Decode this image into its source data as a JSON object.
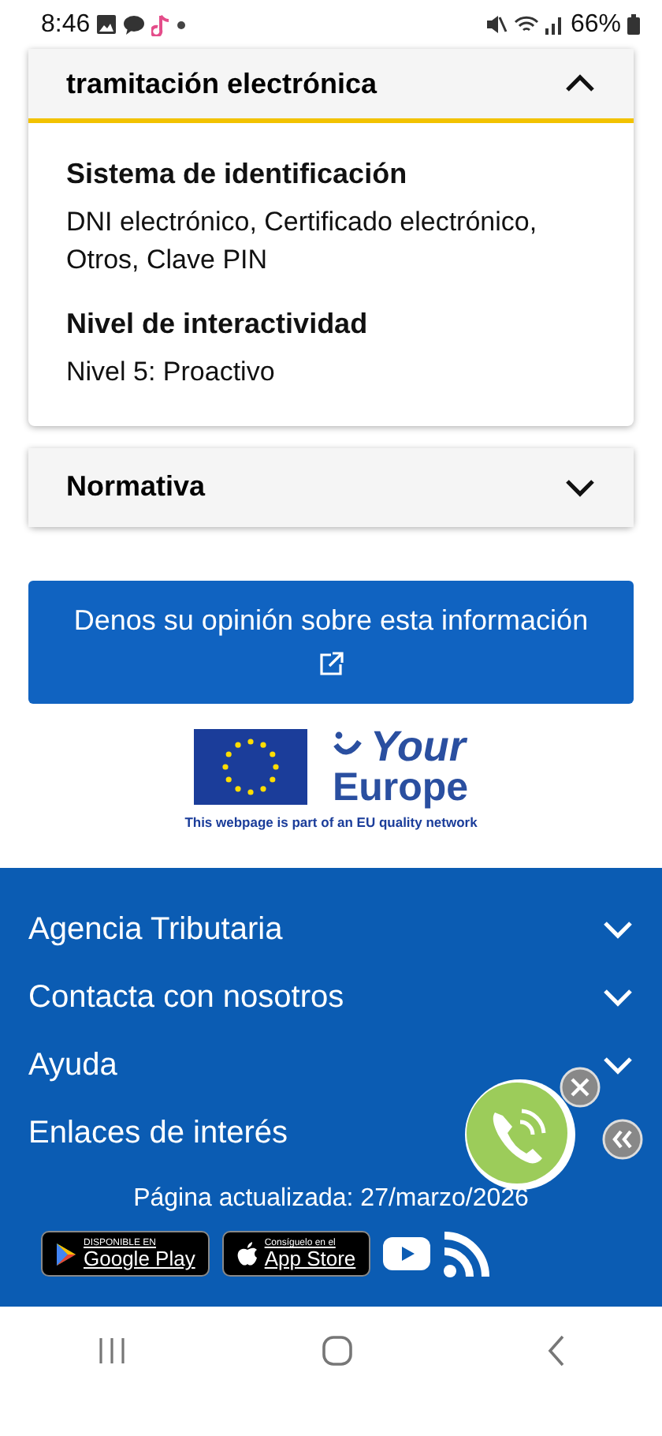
{
  "status_bar": {
    "time": "8:46",
    "battery": "66%"
  },
  "accordions": [
    {
      "title": "tramitación electrónica",
      "expanded": true,
      "fields": [
        {
          "label": "Sistema de identificación",
          "value": "DNI electrónico, Certificado electrónico, Otros, Clave PIN"
        },
        {
          "label": "Nivel de interactividad",
          "value": "Nivel 5: Proactivo"
        }
      ]
    },
    {
      "title": "Normativa",
      "expanded": false
    }
  ],
  "feedback_button": "Denos su opinión sobre esta información",
  "eu_logo": {
    "name_top": "Your",
    "name_bottom": "Europe",
    "caption": "This webpage is part of an EU quality network"
  },
  "footer": {
    "links": [
      {
        "label": "Agencia Tributaria",
        "expanded": false
      },
      {
        "label": "Contacta con nosotros",
        "expanded": false
      },
      {
        "label": "Ayuda",
        "expanded": false
      },
      {
        "label": "Enlaces de interés"
      }
    ],
    "updated": "Página actualizada: 27/marzo/2026",
    "badges": [
      {
        "kind": "google",
        "small": "DISPONIBLE EN",
        "big": "Google Play"
      },
      {
        "kind": "apple",
        "small": "Consíguelo en el",
        "big": "App Store"
      }
    ]
  }
}
